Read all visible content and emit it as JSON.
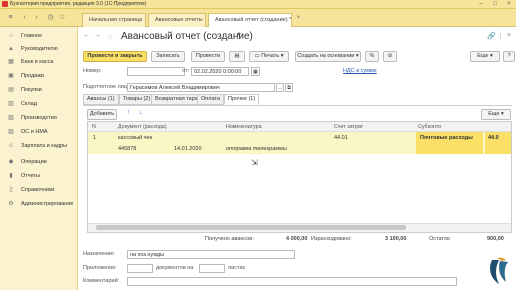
{
  "titlebar": {
    "title": "Бухгалтерия предприятия, редакция 3.0  (1С:Предприятие)"
  },
  "tabs": [
    {
      "label": "Начальная страница"
    },
    {
      "label": "Авансовые отчеты"
    },
    {
      "label": "Авансовый отчет (создание) *"
    }
  ],
  "sidebar": {
    "items": [
      {
        "label": "Главное",
        "icon": "home-icon"
      },
      {
        "label": "Руководителю",
        "icon": "chart-icon"
      },
      {
        "label": "Банк и касса",
        "icon": "bank-icon"
      },
      {
        "label": "Продажи",
        "icon": "cart-icon"
      },
      {
        "label": "Покупки",
        "icon": "basket-icon"
      },
      {
        "label": "Склад",
        "icon": "warehouse-icon"
      },
      {
        "label": "Производство",
        "icon": "factory-icon"
      },
      {
        "label": "ОС и НМА",
        "icon": "building-icon"
      },
      {
        "label": "Зарплата и кадры",
        "icon": "people-icon"
      },
      {
        "label": "Операции",
        "icon": "operations-icon"
      },
      {
        "label": "Отчеты",
        "icon": "reports-icon"
      },
      {
        "label": "Справочники",
        "icon": "book-icon"
      },
      {
        "label": "Администрирование",
        "icon": "gear-icon"
      }
    ]
  },
  "header": {
    "title": "Авансовый отчет (создание)",
    "star": "*"
  },
  "toolbar": {
    "post_close": "Провести и закрыть",
    "save": "Записать",
    "post": "Провести",
    "print": "Печать",
    "create_based": "Создать на основании",
    "more": "Еще"
  },
  "form": {
    "number_label": "Номер:",
    "number_value": "",
    "from_label": "от:",
    "date_value": "02.02.2020  0:00:00",
    "vat_link": "НДС в сумме",
    "person_label": "Подотчетное лицо:",
    "person_value": "Герасимов Алексей Владимирович"
  },
  "doc_tabs": [
    {
      "label": "Авансы (1)"
    },
    {
      "label": "Товары (2)"
    },
    {
      "label": "Возвратная тара"
    },
    {
      "label": "Оплата"
    },
    {
      "label": "Прочее (1)"
    }
  ],
  "table_toolbar": {
    "add": "Добавить",
    "more": "Еще"
  },
  "table": {
    "columns": [
      "N",
      "Документ (расхода)",
      "Номенклатура",
      "Счет затрат",
      "Субконто",
      ""
    ],
    "rows": [
      {
        "n": "1",
        "doc": "кассовый чек",
        "doc_number": "445878",
        "doc_date": "14.01.2020",
        "nomenclature": "отправка телеграммы",
        "account": "44.01",
        "subconto": "Почтовые расходы",
        "extra": "44.0"
      }
    ]
  },
  "totals": {
    "advance_label": "Получено авансов:",
    "advance_value": "4 000,00",
    "spent_label": "Израсходовано:",
    "spent_value": "3 100,00",
    "balance_label": "Остаток:",
    "balance_value": "900,00"
  },
  "bottom": {
    "purpose_label": "Назначение:",
    "purpose_value": "на хоз.нужды",
    "attachment_label": "Приложение:",
    "attachment_docs": "документов на",
    "attachment_sheets": "листах",
    "comment_label": "Комментарий:"
  }
}
